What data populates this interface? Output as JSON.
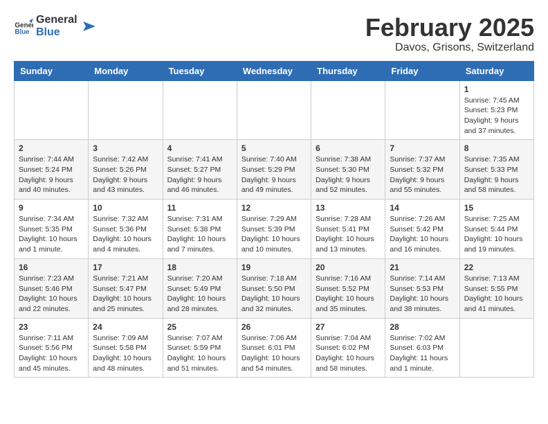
{
  "logo": {
    "text_general": "General",
    "text_blue": "Blue"
  },
  "title": {
    "month": "February 2025",
    "location": "Davos, Grisons, Switzerland"
  },
  "weekdays": [
    "Sunday",
    "Monday",
    "Tuesday",
    "Wednesday",
    "Thursday",
    "Friday",
    "Saturday"
  ],
  "weeks": [
    [
      {
        "day": "",
        "info": ""
      },
      {
        "day": "",
        "info": ""
      },
      {
        "day": "",
        "info": ""
      },
      {
        "day": "",
        "info": ""
      },
      {
        "day": "",
        "info": ""
      },
      {
        "day": "",
        "info": ""
      },
      {
        "day": "1",
        "info": "Sunrise: 7:45 AM\nSunset: 5:23 PM\nDaylight: 9 hours and 37 minutes."
      }
    ],
    [
      {
        "day": "2",
        "info": "Sunrise: 7:44 AM\nSunset: 5:24 PM\nDaylight: 9 hours and 40 minutes."
      },
      {
        "day": "3",
        "info": "Sunrise: 7:42 AM\nSunset: 5:26 PM\nDaylight: 9 hours and 43 minutes."
      },
      {
        "day": "4",
        "info": "Sunrise: 7:41 AM\nSunset: 5:27 PM\nDaylight: 9 hours and 46 minutes."
      },
      {
        "day": "5",
        "info": "Sunrise: 7:40 AM\nSunset: 5:29 PM\nDaylight: 9 hours and 49 minutes."
      },
      {
        "day": "6",
        "info": "Sunrise: 7:38 AM\nSunset: 5:30 PM\nDaylight: 9 hours and 52 minutes."
      },
      {
        "day": "7",
        "info": "Sunrise: 7:37 AM\nSunset: 5:32 PM\nDaylight: 9 hours and 55 minutes."
      },
      {
        "day": "8",
        "info": "Sunrise: 7:35 AM\nSunset: 5:33 PM\nDaylight: 9 hours and 58 minutes."
      }
    ],
    [
      {
        "day": "9",
        "info": "Sunrise: 7:34 AM\nSunset: 5:35 PM\nDaylight: 10 hours and 1 minute."
      },
      {
        "day": "10",
        "info": "Sunrise: 7:32 AM\nSunset: 5:36 PM\nDaylight: 10 hours and 4 minutes."
      },
      {
        "day": "11",
        "info": "Sunrise: 7:31 AM\nSunset: 5:38 PM\nDaylight: 10 hours and 7 minutes."
      },
      {
        "day": "12",
        "info": "Sunrise: 7:29 AM\nSunset: 5:39 PM\nDaylight: 10 hours and 10 minutes."
      },
      {
        "day": "13",
        "info": "Sunrise: 7:28 AM\nSunset: 5:41 PM\nDaylight: 10 hours and 13 minutes."
      },
      {
        "day": "14",
        "info": "Sunrise: 7:26 AM\nSunset: 5:42 PM\nDaylight: 10 hours and 16 minutes."
      },
      {
        "day": "15",
        "info": "Sunrise: 7:25 AM\nSunset: 5:44 PM\nDaylight: 10 hours and 19 minutes."
      }
    ],
    [
      {
        "day": "16",
        "info": "Sunrise: 7:23 AM\nSunset: 5:46 PM\nDaylight: 10 hours and 22 minutes."
      },
      {
        "day": "17",
        "info": "Sunrise: 7:21 AM\nSunset: 5:47 PM\nDaylight: 10 hours and 25 minutes."
      },
      {
        "day": "18",
        "info": "Sunrise: 7:20 AM\nSunset: 5:49 PM\nDaylight: 10 hours and 28 minutes."
      },
      {
        "day": "19",
        "info": "Sunrise: 7:18 AM\nSunset: 5:50 PM\nDaylight: 10 hours and 32 minutes."
      },
      {
        "day": "20",
        "info": "Sunrise: 7:16 AM\nSunset: 5:52 PM\nDaylight: 10 hours and 35 minutes."
      },
      {
        "day": "21",
        "info": "Sunrise: 7:14 AM\nSunset: 5:53 PM\nDaylight: 10 hours and 38 minutes."
      },
      {
        "day": "22",
        "info": "Sunrise: 7:13 AM\nSunset: 5:55 PM\nDaylight: 10 hours and 41 minutes."
      }
    ],
    [
      {
        "day": "23",
        "info": "Sunrise: 7:11 AM\nSunset: 5:56 PM\nDaylight: 10 hours and 45 minutes."
      },
      {
        "day": "24",
        "info": "Sunrise: 7:09 AM\nSunset: 5:58 PM\nDaylight: 10 hours and 48 minutes."
      },
      {
        "day": "25",
        "info": "Sunrise: 7:07 AM\nSunset: 5:59 PM\nDaylight: 10 hours and 51 minutes."
      },
      {
        "day": "26",
        "info": "Sunrise: 7:06 AM\nSunset: 6:01 PM\nDaylight: 10 hours and 54 minutes."
      },
      {
        "day": "27",
        "info": "Sunrise: 7:04 AM\nSunset: 6:02 PM\nDaylight: 10 hours and 58 minutes."
      },
      {
        "day": "28",
        "info": "Sunrise: 7:02 AM\nSunset: 6:03 PM\nDaylight: 11 hours and 1 minute."
      },
      {
        "day": "",
        "info": ""
      }
    ]
  ]
}
